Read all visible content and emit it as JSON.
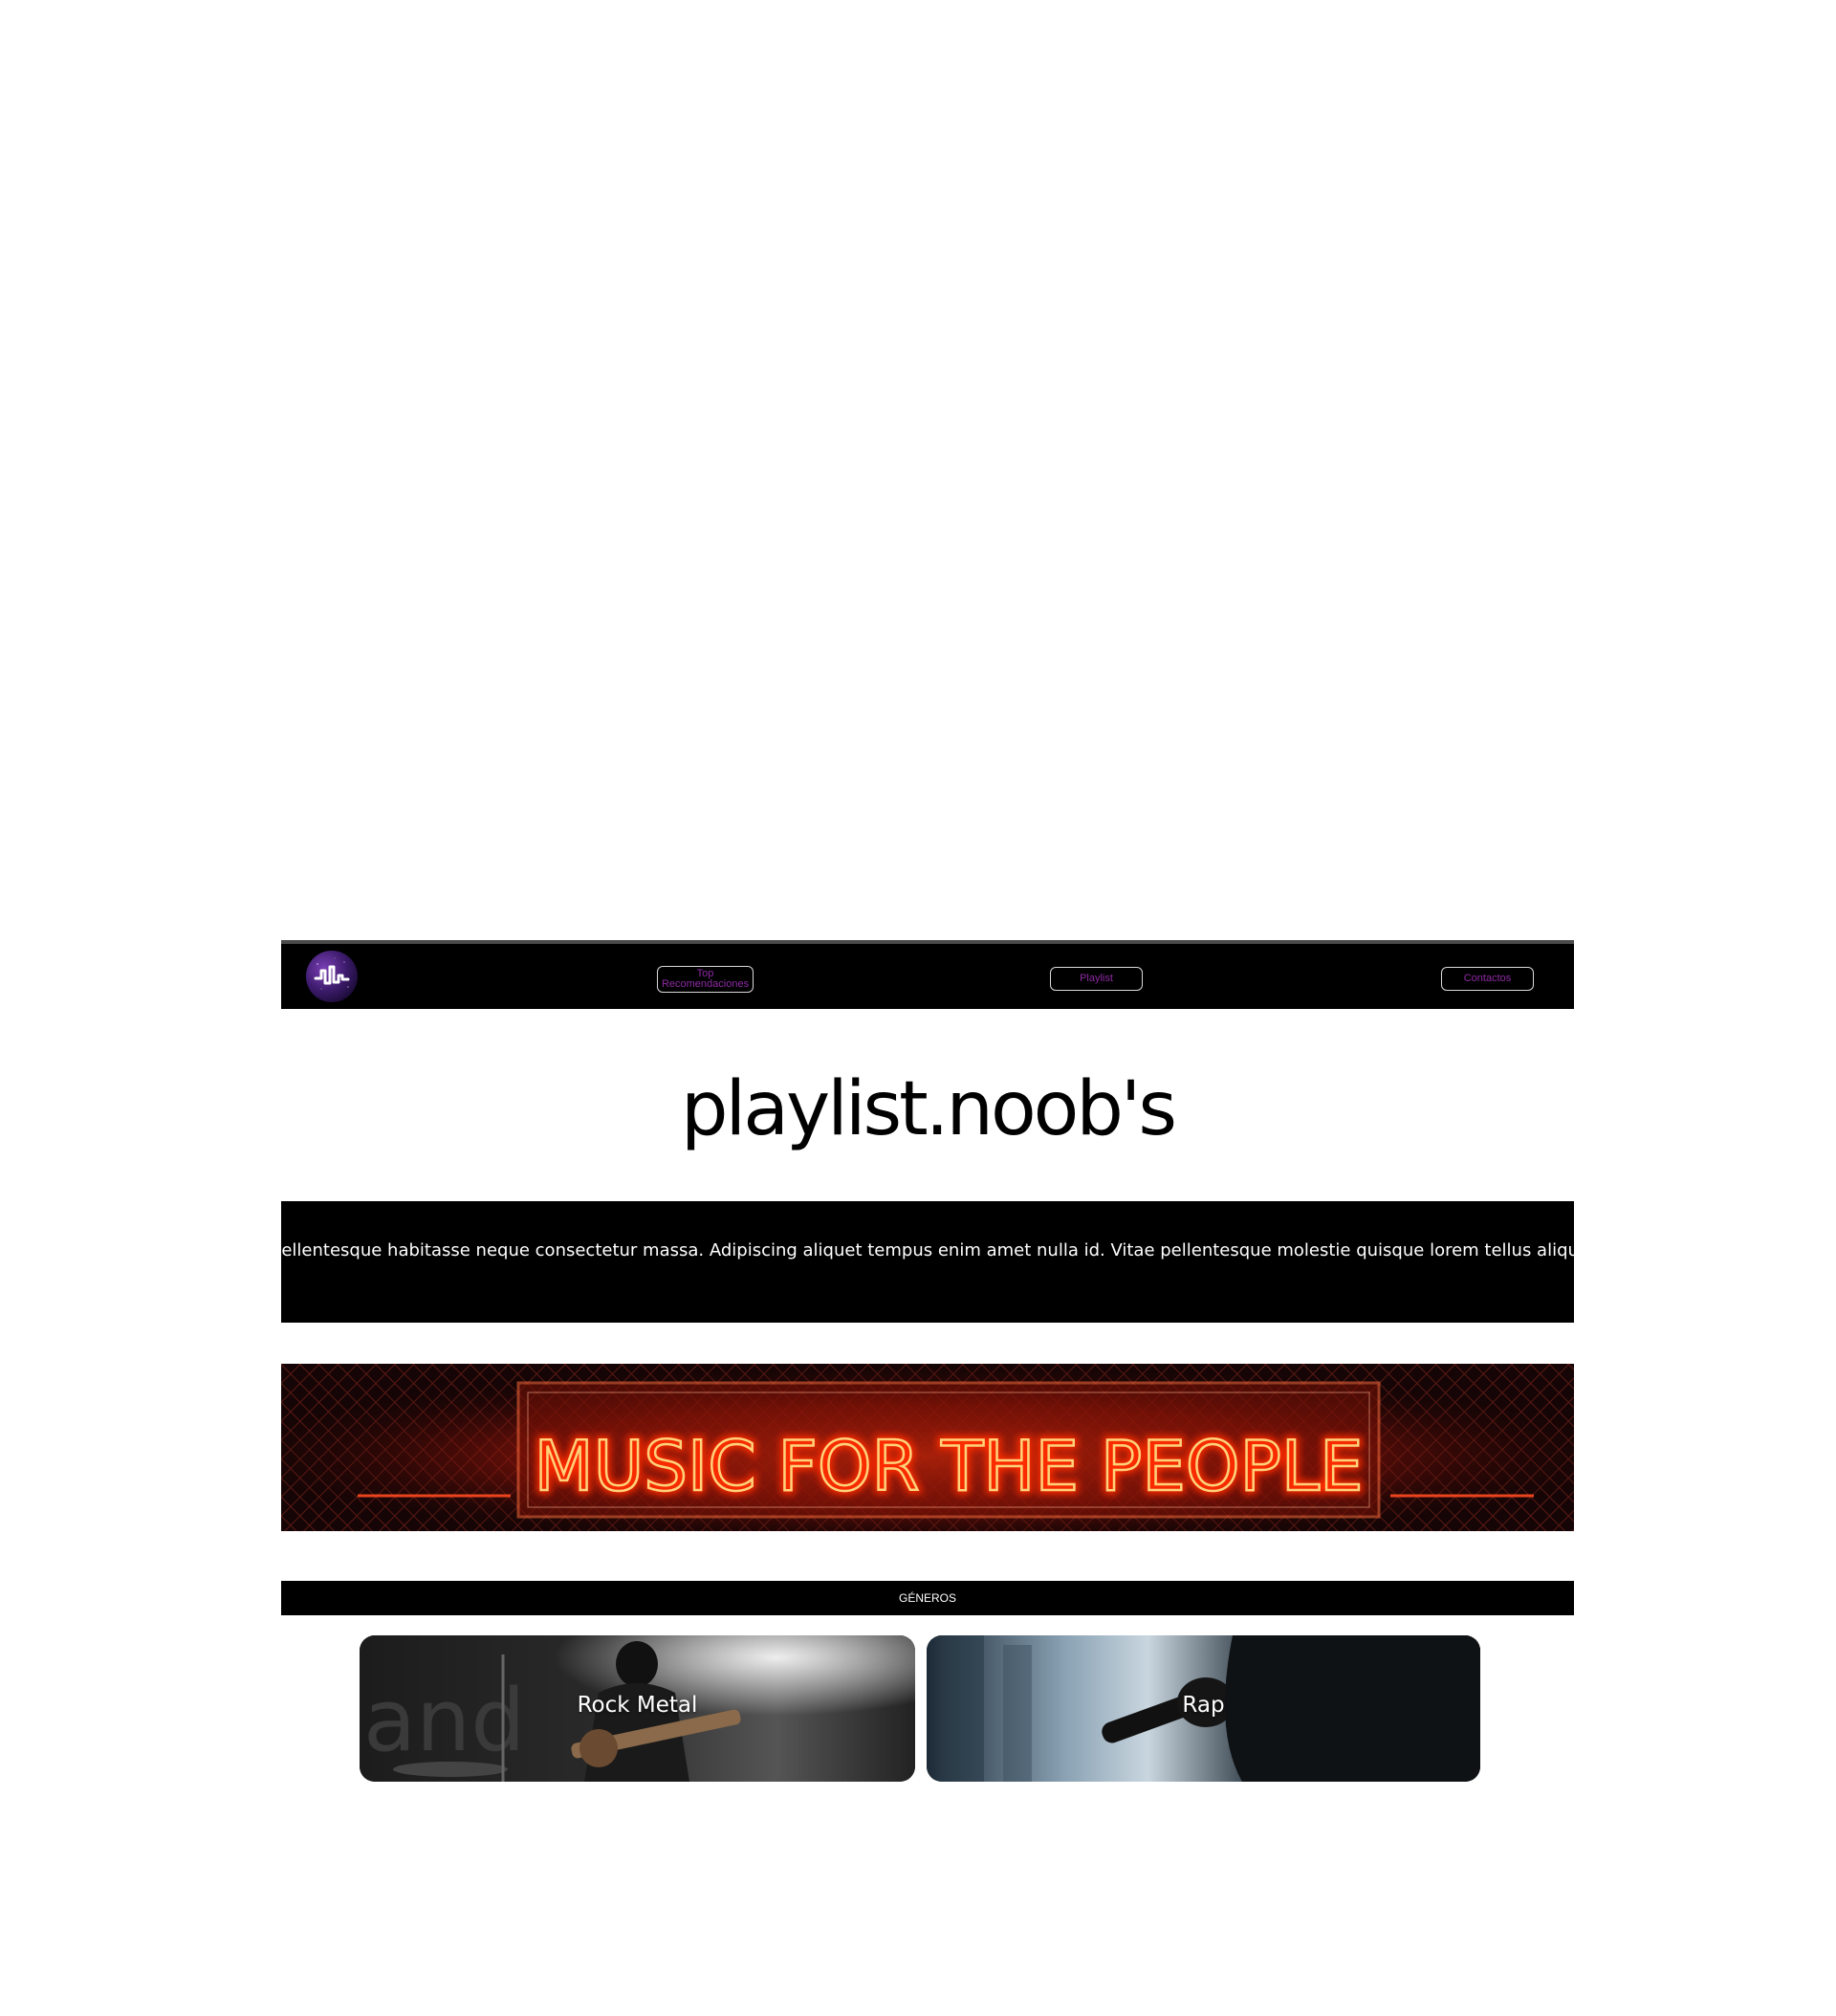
{
  "nav": {
    "logo": "musical-logo",
    "items": [
      {
        "label": "Top Recomendaciones"
      },
      {
        "label": "Playlist"
      },
      {
        "label": "Contactos"
      }
    ],
    "button_text_color": "#8e2aa3",
    "button_border_color": "#d9d9d9"
  },
  "hero": {
    "title": "playlist.noob's"
  },
  "intro": {
    "text": "Lorem ipsum dolor sit amet, consectetur adipiscing elit. In pellentesque habitasse neque consectetur massa. Adipiscing aliquet tempus enim amet nulla id. Vitae pellentesque molestie quisque lorem tellus aliquam.Lorem ipsum dolor sit amet, consectetur adipiscing elit."
  },
  "banner": {
    "sign_text": "MUSIC FOR THE PEOPLE",
    "neon_color": "#ff3b12"
  },
  "genres": {
    "heading": "GÉNEROS",
    "cards": [
      {
        "label": "Rock Metal"
      },
      {
        "label": "Rap"
      }
    ]
  }
}
